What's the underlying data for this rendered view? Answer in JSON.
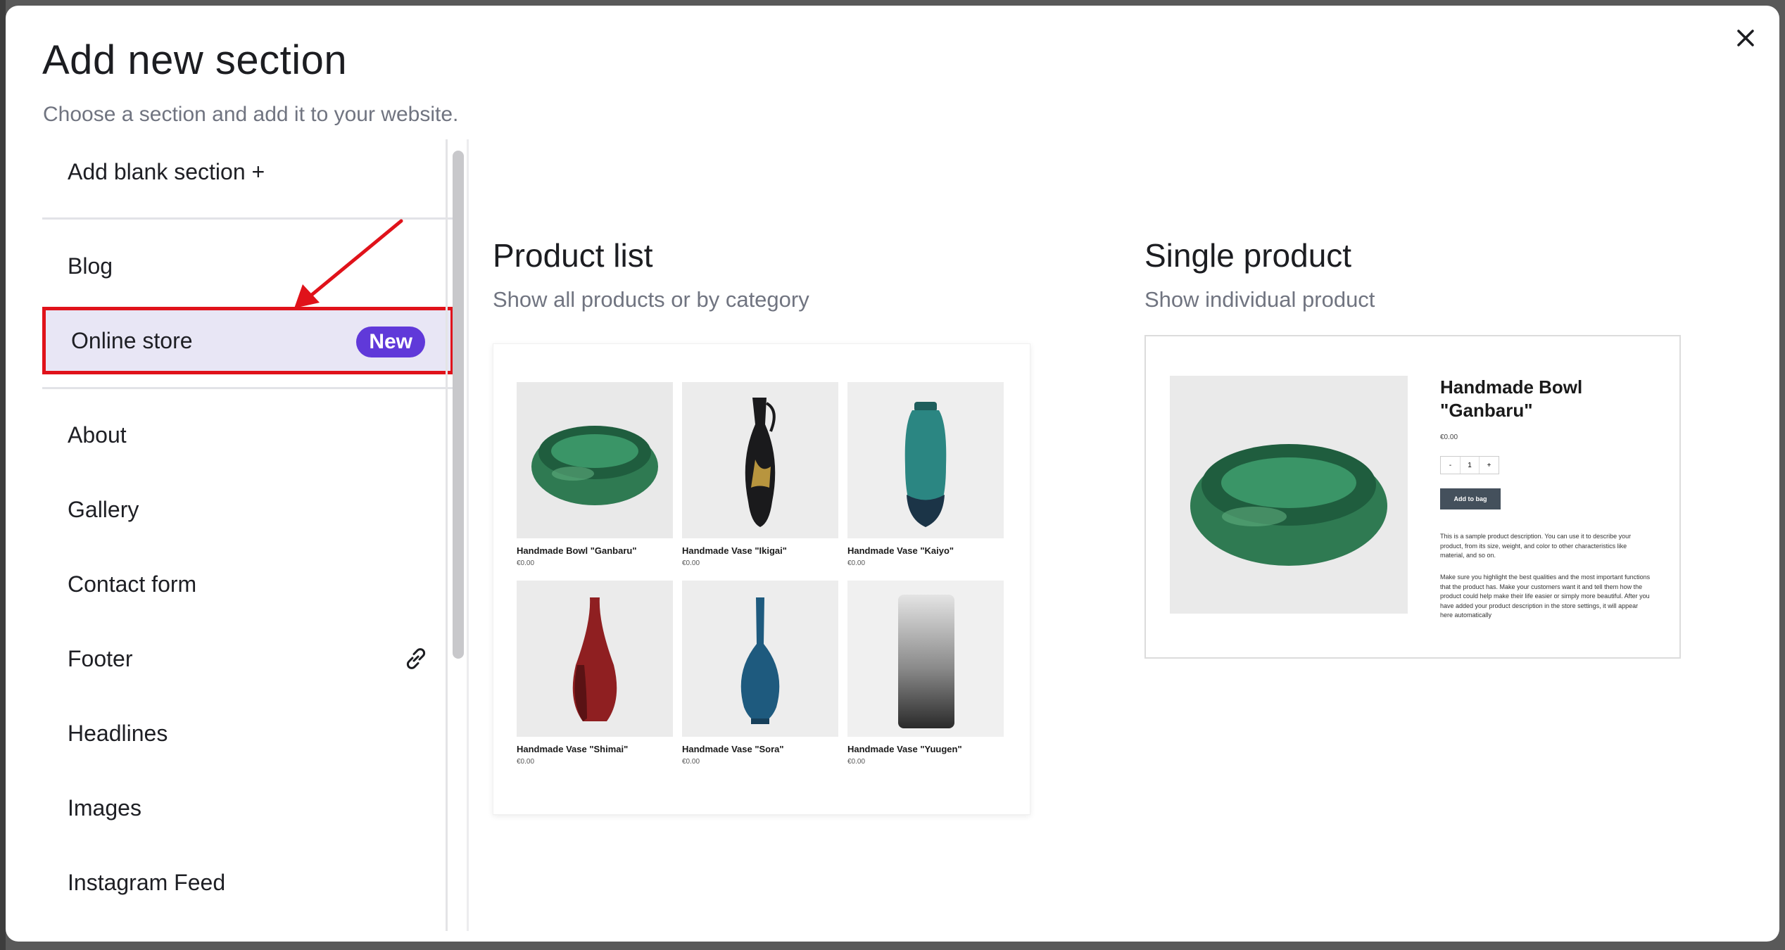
{
  "header": {
    "title": "Add new section",
    "subtitle": "Choose a section and add it to your website."
  },
  "sidebar": {
    "items": [
      {
        "label": "Add blank section +"
      },
      {
        "label": "Blog"
      },
      {
        "label": "Online store",
        "badge": "New"
      },
      {
        "label": "About"
      },
      {
        "label": "Gallery"
      },
      {
        "label": "Contact form"
      },
      {
        "label": "Footer",
        "icon": "link-icon"
      },
      {
        "label": "Headlines"
      },
      {
        "label": "Images"
      },
      {
        "label": "Instagram Feed"
      }
    ]
  },
  "sections": [
    {
      "title": "Product list",
      "subtitle": "Show all products or by category",
      "products": [
        {
          "name": "Handmade Bowl \"Ganbaru\"",
          "price": "€0.00"
        },
        {
          "name": "Handmade Vase \"Ikigai\"",
          "price": "€0.00"
        },
        {
          "name": "Handmade Vase \"Kaiyo\"",
          "price": "€0.00"
        },
        {
          "name": "Handmade Vase \"Shimai\"",
          "price": "€0.00"
        },
        {
          "name": "Handmade Vase \"Sora\"",
          "price": "€0.00"
        },
        {
          "name": "Handmade Vase \"Yuugen\"",
          "price": "€0.00"
        }
      ]
    },
    {
      "title": "Single product",
      "subtitle": "Show individual product",
      "product": {
        "name": "Handmade Bowl \"Ganbaru\"",
        "price": "€0.00",
        "qty_minus": "-",
        "qty_value": "1",
        "qty_plus": "+",
        "add_button": "Add to bag",
        "desc1": "This is a sample product description. You can use it to describe your product, from its size, weight, and color to other characteristics like material, and so on.",
        "desc2": "Make sure you highlight the best qualities and the most important functions that the product has. Make your customers want it and tell them how the product could help make their life easier or simply more beautiful. After you have added your product description in the store settings, it will appear here automatically"
      }
    }
  ],
  "colors": {
    "accent": "#6039d9",
    "highlight_border": "#e0121a",
    "selected_bg": "#e8e6f5",
    "annotation_arrow": "#e0121a"
  }
}
